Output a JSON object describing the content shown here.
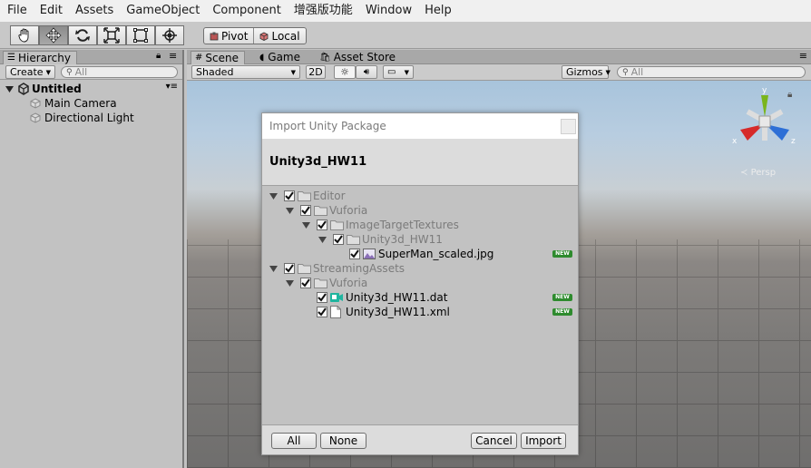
{
  "menu": [
    "File",
    "Edit",
    "Assets",
    "GameObject",
    "Component",
    "增强版功能",
    "Window",
    "Help"
  ],
  "toolbar": {
    "pivot_label": "Pivot",
    "local_label": "Local"
  },
  "hierarchy": {
    "tab_label": "Hierarchy",
    "create_label": "Create",
    "search_placeholder": "All",
    "scene_name": "Untitled",
    "items": [
      "Main Camera",
      "Directional Light"
    ]
  },
  "scene_tabs": [
    "Scene",
    "Game",
    "Asset Store"
  ],
  "scene_bar": {
    "shading_mode": "Shaded",
    "mode_2d": "2D",
    "gizmos_label": "Gizmos",
    "search_placeholder": "All"
  },
  "gizmo": {
    "axis_y": "y",
    "axis_x": "x",
    "axis_z": "z",
    "persp_label": "Persp"
  },
  "dialog": {
    "title": "Import Unity Package",
    "package_name": "Unity3d_HW11",
    "new_badge": "NEW",
    "tree": [
      {
        "label": "Editor"
      },
      {
        "label": "Vuforia"
      },
      {
        "label": "ImageTargetTextures"
      },
      {
        "label": "Unity3d_HW11"
      },
      {
        "label": "SuperMan_scaled.jpg"
      },
      {
        "label": "StreamingAssets"
      },
      {
        "label": "Vuforia"
      },
      {
        "label": "Unity3d_HW11.dat"
      },
      {
        "label": "Unity3d_HW11.xml"
      }
    ],
    "buttons": {
      "all": "All",
      "none": "None",
      "cancel": "Cancel",
      "import": "Import"
    }
  },
  "colors": {
    "new_badge": "#2e8b2e",
    "x_axis": "#d62a2a",
    "y_axis": "#7ab51d",
    "z_axis": "#2d6fd6",
    "dat_icon": "#1fb59f"
  }
}
